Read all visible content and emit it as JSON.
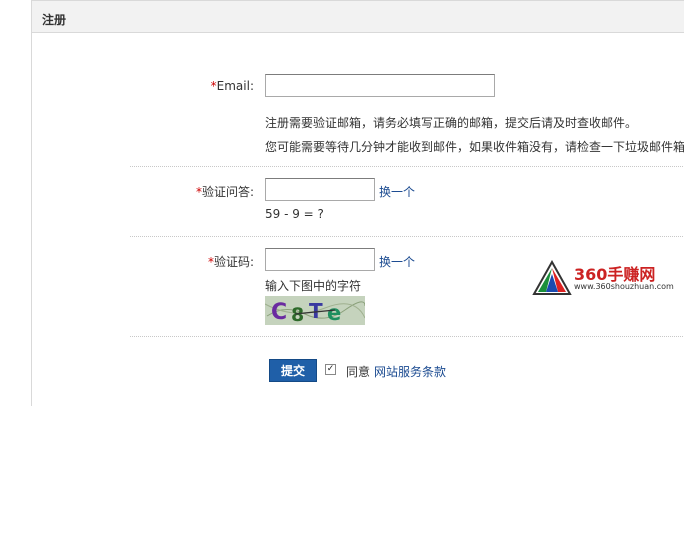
{
  "header": {
    "title": "注册"
  },
  "form": {
    "email": {
      "required_mark": "*",
      "label": "Email:",
      "value": ""
    },
    "email_hints": [
      "注册需要验证邮箱，请务必填写正确的邮箱，提交后请及时查收邮件。",
      "您可能需要等待几分钟才能收到邮件，如果收件箱没有，请检查一下垃圾邮件箱"
    ],
    "question": {
      "required_mark": "*",
      "label": "验证问答:",
      "value": "",
      "change_link": "换一个",
      "prompt": "59 - 9 = ?"
    },
    "captcha": {
      "required_mark": "*",
      "label": "验证码:",
      "value": "",
      "change_link": "换一个",
      "hint": "输入下图中的字符",
      "image_text": "C8Te"
    },
    "submit": {
      "label": "提交"
    },
    "agree": {
      "checked": true,
      "label": "同意",
      "link": "网站服务条款"
    }
  },
  "watermark": {
    "brand": "360手赚网",
    "url": "www.360shouzhuan.com"
  }
}
